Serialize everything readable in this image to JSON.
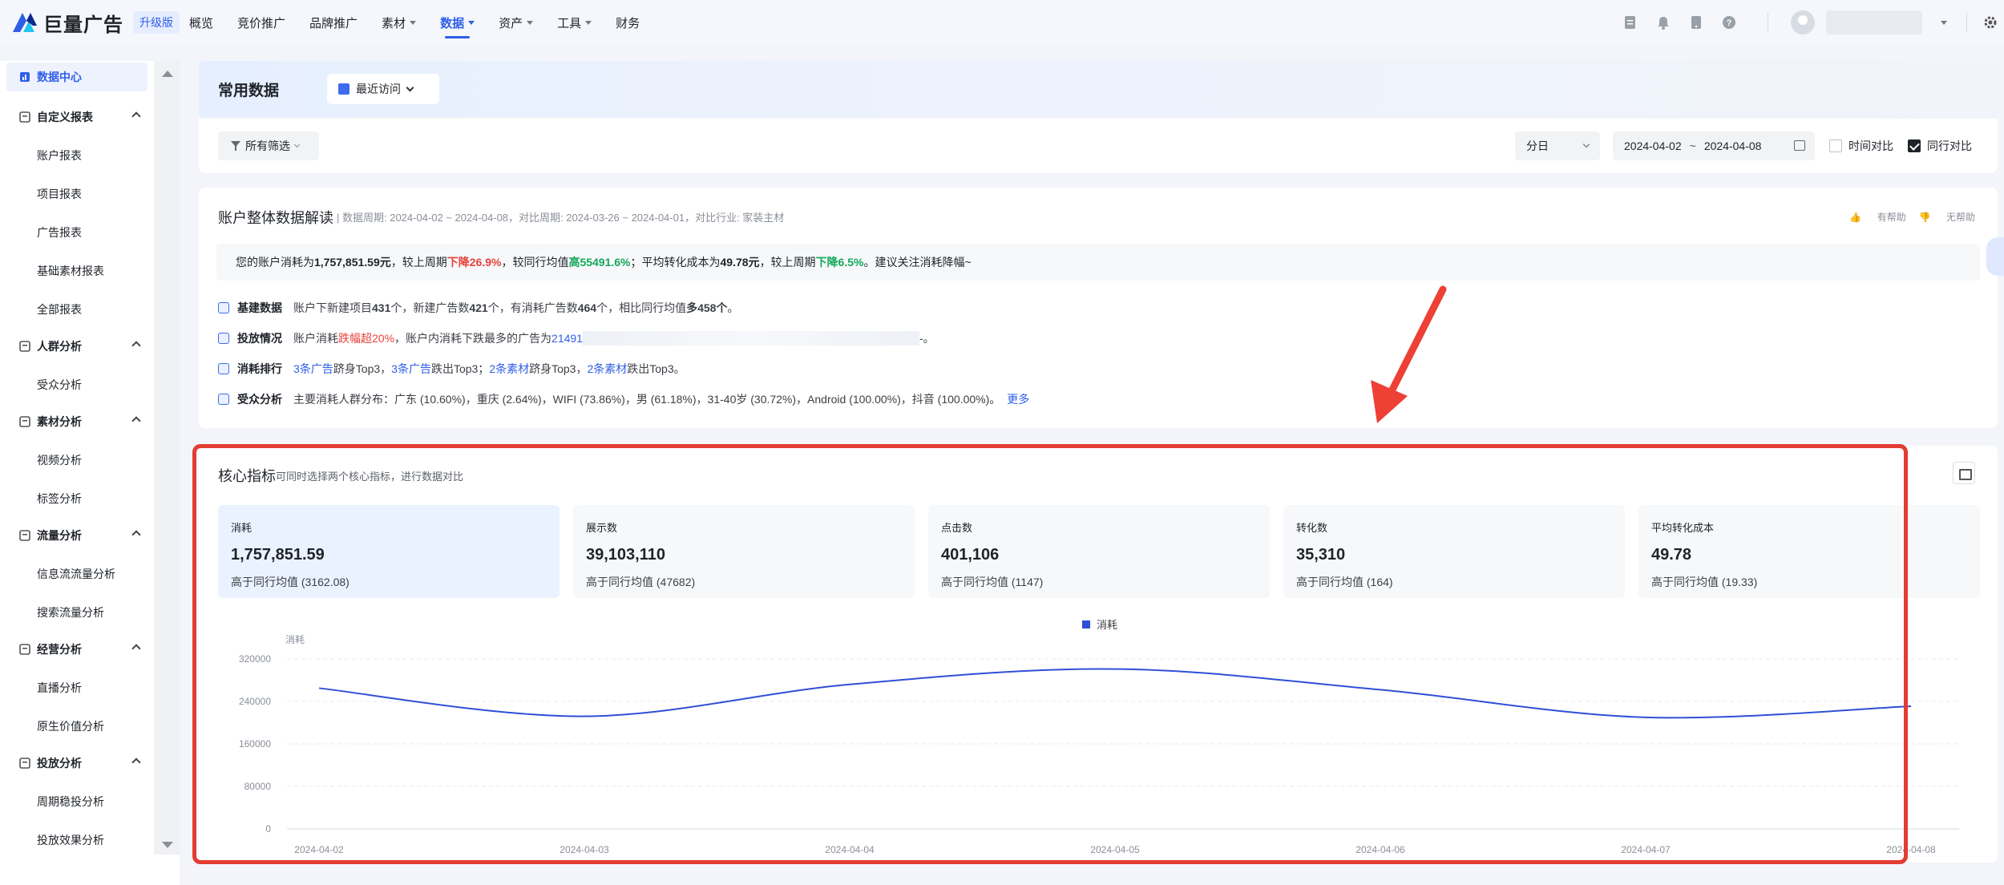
{
  "brand": {
    "name": "巨量广告",
    "badge": "升级版",
    "accent": "#2f5ee8"
  },
  "nav": [
    {
      "label": "概览",
      "caret": false,
      "active": false
    },
    {
      "label": "竞价推广",
      "caret": false,
      "active": false
    },
    {
      "label": "品牌推广",
      "caret": false,
      "active": false
    },
    {
      "label": "素材",
      "caret": true,
      "active": false
    },
    {
      "label": "数据",
      "caret": true,
      "active": true
    },
    {
      "label": "资产",
      "caret": true,
      "active": false
    },
    {
      "label": "工具",
      "caret": true,
      "active": false
    },
    {
      "label": "财务",
      "caret": false,
      "active": false
    }
  ],
  "sidebar": {
    "active": "数据中心",
    "groups": [
      {
        "label": "自定义报表",
        "items": [
          "账户报表",
          "项目报表",
          "广告报表",
          "基础素材报表",
          "全部报表"
        ]
      },
      {
        "label": "人群分析",
        "items": [
          "受众分析"
        ]
      },
      {
        "label": "素材分析",
        "items": [
          "视频分析",
          "标签分析"
        ]
      },
      {
        "label": "流量分析",
        "items": [
          "信息流流量分析",
          "搜索流量分析"
        ]
      },
      {
        "label": "经营分析",
        "items": [
          "直播分析",
          "原生价值分析"
        ]
      },
      {
        "label": "投放分析",
        "items": [
          "周期稳投分析",
          "投放效果分析"
        ]
      }
    ]
  },
  "header": {
    "title": "常用数据",
    "recent_label": "最近访问"
  },
  "filter": {
    "all_filters": "所有筛选",
    "granularity": "分日",
    "date_start": "2024-04-02",
    "date_sep": "~",
    "date_end": "2024-04-08",
    "time_compare": "时间对比",
    "peer_compare": "同行对比",
    "peer_checked": true,
    "time_checked": false
  },
  "interpretation": {
    "title": "账户整体数据解读",
    "meta": "数据周期: 2024-04-02 ~ 2024-04-08，对比周期: 2024-03-26 ~ 2024-04-01，对比行业: 家装主材",
    "helpful": "有帮助",
    "not_helpful": "无帮助",
    "summary": {
      "p1": "您的账户消耗为",
      "cost": "1,757,851.59元",
      "p2": "，较上周期",
      "down1": "下降26.9%",
      "p3": "，较同行均值",
      "up1": "高55491.6%",
      "p4": "；平均转化成本为",
      "cpa": "49.78元",
      "p5": "，较上周期",
      "down2": "下降6.5%",
      "p6": "。建议关注消耗降幅~"
    },
    "rows": {
      "build": {
        "title": "基建数据",
        "a": "账户下新建项目",
        "n1": "431",
        "b": "个，新建广告数",
        "n2": "421",
        "c": "个，有消耗广告数",
        "n3": "464",
        "d": "个，相比同行均值",
        "n4": "多458个",
        "e": "。"
      },
      "delivery": {
        "title": "投放情况",
        "a": "账户消耗",
        "warn": "跌幅超20%",
        "b": "，账户内消耗下跌最多的广告为",
        "ad_id": "21491",
        "c": "-。"
      },
      "rank": {
        "title": "消耗排行",
        "l1": "3条广告",
        "t1": "跻身Top3，",
        "l2": "3条广告",
        "t2": "跌出Top3；",
        "l3": "2条素材",
        "t3": "跻身Top3，",
        "l4": "2条素材",
        "t4": "跌出Top3。"
      },
      "audience": {
        "title": "受众分析",
        "a": "主要消耗人群分布：",
        "text": "广东 (10.60%)，重庆 (2.64%)，WIFI (73.86%)，男 (61.18%)，31-40岁 (30.72%)，Android (100.00%)，抖音 (100.00%)。",
        "more": "更多"
      }
    }
  },
  "core": {
    "title": "核心指标",
    "subtitle": "可同时选择两个核心指标，进行数据对比",
    "cards": [
      {
        "label": "消耗",
        "value": "1,757,851.59",
        "sub": "高于同行均值 (3162.08)",
        "selected": true
      },
      {
        "label": "展示数",
        "value": "39,103,110",
        "sub": "高于同行均值 (47682)",
        "selected": false
      },
      {
        "label": "点击数",
        "value": "401,106",
        "sub": "高于同行均值 (1147)",
        "selected": false
      },
      {
        "label": "转化数",
        "value": "35,310",
        "sub": "高于同行均值 (164)",
        "selected": false
      },
      {
        "label": "平均转化成本",
        "value": "49.78",
        "sub": "高于同行均值 (19.33)",
        "selected": false
      }
    ]
  },
  "chart_data": {
    "type": "line",
    "ylabel": "消耗",
    "x": [
      "2024-04-02",
      "2024-04-03",
      "2024-04-04",
      "2024-04-05",
      "2024-04-06",
      "2024-04-07",
      "2024-04-08"
    ],
    "series": [
      {
        "name": "消耗",
        "values": [
          265000,
          212000,
          272000,
          301000,
          262000,
          210000,
          231000
        ],
        "color": "#2f4fd8"
      }
    ],
    "ylim": [
      0,
      320000
    ],
    "yticks": [
      0,
      80000,
      160000,
      240000,
      320000
    ],
    "grid": true,
    "legend": "top-center"
  }
}
